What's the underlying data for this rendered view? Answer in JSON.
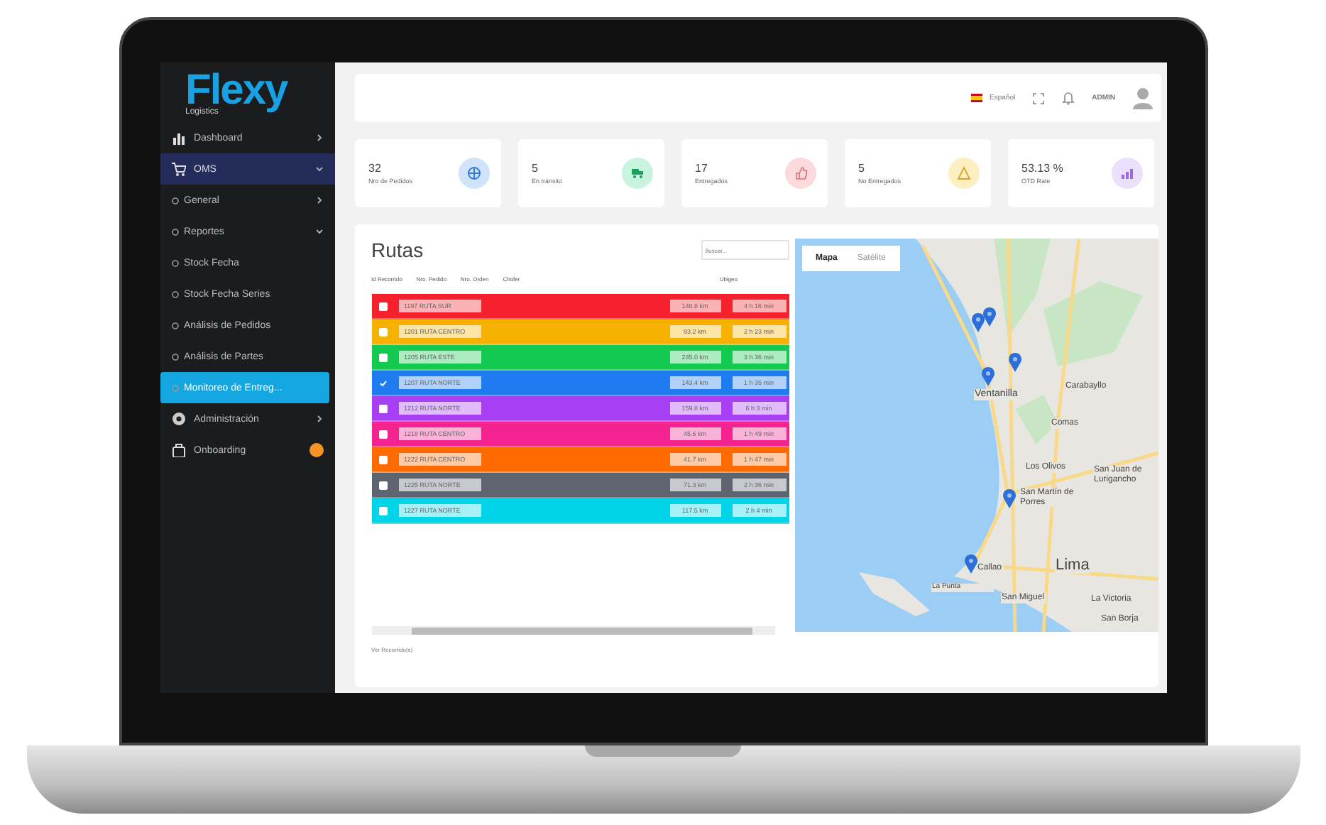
{
  "sidebar": {
    "logo": {
      "name": "Flexy",
      "tagline": "Logistics"
    },
    "items": [
      {
        "label": "Dashboard",
        "expanded": false,
        "selected": false
      },
      {
        "label": "OMS",
        "expanded": true,
        "selected": true,
        "children": [
          {
            "label": "General",
            "expanded": false,
            "selected": false
          },
          {
            "label": "Reportes",
            "expanded": true,
            "selected": false,
            "children": [
              {
                "label": "Stock Fecha",
                "selected": false
              },
              {
                "label": "Stock Fecha Series",
                "selected": false
              },
              {
                "label": "Análisis de Pedidos",
                "selected": false
              },
              {
                "label": "Análisis de Partes",
                "selected": false
              },
              {
                "label": "Monitoreo de Entreg...",
                "selected": true
              }
            ]
          }
        ]
      },
      {
        "label": "Administración",
        "expanded": false,
        "selected": false
      },
      {
        "label": "Onboarding",
        "selected": false,
        "badge_dot": true
      }
    ]
  },
  "header": {
    "language": "Español",
    "user": "ADMIN"
  },
  "stats": [
    {
      "value": "32",
      "label": "Nro de Pedidos",
      "color": "#cfe3fb"
    },
    {
      "value": "5",
      "label": "En tránsito",
      "color": "#c8f3df"
    },
    {
      "value": "17",
      "label": "Entregados",
      "color": "#fbd9dc"
    },
    {
      "value": "5",
      "label": "No Entregados",
      "color": "#fcefc2"
    },
    {
      "value": "53.13 %",
      "label": "OTD Rate",
      "color": "#ebe0fb"
    }
  ],
  "routes": {
    "title": "Rutas",
    "search": {
      "placeholder": "Buscar..."
    },
    "columns": [
      "Id Recorrido",
      "Nro. Pedido",
      "Nro. Orden",
      "Chofer",
      "Ubigeo"
    ],
    "rows": [
      {
        "route": "1197 RUTA SUR",
        "distance": "148.8 km",
        "time": "4 h 16 min",
        "checked": false,
        "color": "#f5222d"
      },
      {
        "route": "1201 RUTA CENTRO",
        "distance": "93.2 km",
        "time": "2 h 23 min",
        "checked": false,
        "color": "#f5b000"
      },
      {
        "route": "1205 RUTA ESTE",
        "distance": "235.0 km",
        "time": "3 h 36 min",
        "checked": false,
        "color": "#14c94f"
      },
      {
        "route": "1207 RUTA NORTE",
        "distance": "143.4 km",
        "time": "1 h 35 min",
        "checked": true,
        "color": "#1e7bf0"
      },
      {
        "route": "1212 RUTA NORTE",
        "distance": "159.8 km",
        "time": "6 h 3 min",
        "checked": false,
        "color": "#a93ff5"
      },
      {
        "route": "1218 RUTA CENTRO",
        "distance": "45.6 km",
        "time": "1 h 49 min",
        "checked": false,
        "color": "#f4238f"
      },
      {
        "route": "1222 RUTA CENTRO",
        "distance": "41.7 km",
        "time": "1 h 47 min",
        "checked": false,
        "color": "#ff6a00"
      },
      {
        "route": "1225 RUTA NORTE",
        "distance": "71.3 km",
        "time": "2 h 36 min",
        "checked": false,
        "color": "#5d6470"
      },
      {
        "route": "1227 RUTA NORTE",
        "distance": "117.5 km",
        "time": "2 h 4 min",
        "checked": false,
        "color": "#00d4e8"
      }
    ],
    "footer": "Ver Recorrido(s)"
  },
  "map": {
    "tabs": [
      {
        "label": "Mapa",
        "selected": true
      },
      {
        "label": "Satélite",
        "selected": false
      }
    ],
    "places": [
      "Ventanilla",
      "Carabayllo",
      "Comas",
      "Los Olivos",
      "San Juan de Lurigancho",
      "San Martín de Porres",
      "Callao",
      "La Punta",
      "San Miguel",
      "Lima",
      "La Victoria",
      "San Borja"
    ]
  }
}
